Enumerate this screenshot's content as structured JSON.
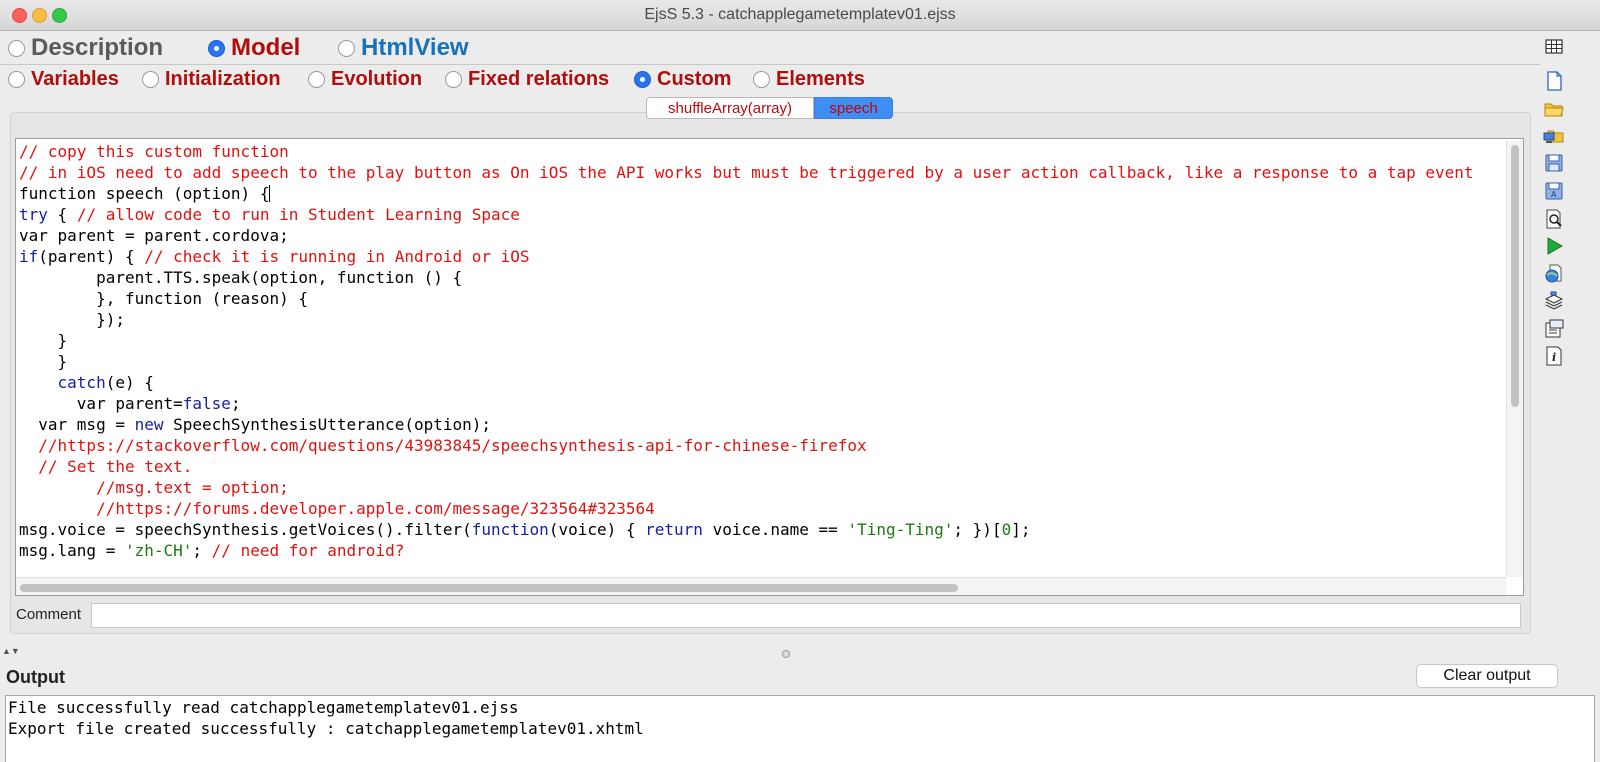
{
  "window": {
    "title": "EjsS 5.3 - catchapplegametemplatev01.ejss"
  },
  "top_nav": [
    {
      "label": "Description",
      "selected": false,
      "color": "#5a5a5a"
    },
    {
      "label": "Model",
      "selected": true,
      "color": "#b20d0d"
    },
    {
      "label": "HtmlView",
      "selected": false,
      "color": "#1772b8"
    }
  ],
  "model_nav": [
    {
      "label": "Variables",
      "selected": false
    },
    {
      "label": "Initialization",
      "selected": false
    },
    {
      "label": "Evolution",
      "selected": false
    },
    {
      "label": "Fixed relations",
      "selected": false
    },
    {
      "label": "Custom",
      "selected": true
    },
    {
      "label": "Elements",
      "selected": false
    }
  ],
  "page_tabs": [
    {
      "label": "shuffleArray(array)",
      "selected": false
    },
    {
      "label": "speech",
      "selected": true
    }
  ],
  "editor": {
    "lines": [
      "// copy this custom function",
      "// in iOS need to add speech to the play button as On iOS the API works but must be triggered by a user action callback, like a response to a tap event",
      "function speech (option) {",
      "try { // allow code to run in Student Learning Space",
      "var parent = parent.cordova;",
      "if(parent) { // check it is running in Android or iOS",
      "        parent.TTS.speak(option, function () {",
      "        }, function (reason) {",
      "        });",
      "    }",
      "    }",
      "    catch(e) {",
      "      var parent=false;",
      "  var msg = new SpeechSynthesisUtterance(option);",
      "  //https://stackoverflow.com/questions/43983845/speechsynthesis-api-for-chinese-firefox",
      "  // Set the text.",
      "        //msg.text = option;",
      "        //https://forums.developer.apple.com/message/323564#323564",
      "msg.voice = speechSynthesis.getVoices().filter(function(voice) { return voice.name == 'Ting-Ting'; })[0];",
      "msg.lang = 'zh-CH'; // need for android?"
    ]
  },
  "comment": {
    "label": "Comment",
    "value": ""
  },
  "output": {
    "label": "Output",
    "clear_label": "Clear output",
    "lines": [
      "File successfully read catchapplegametemplatev01.ejss",
      "Export file created successfully : catchapplegametemplatev01.xhtml"
    ]
  },
  "toolbar_icons": [
    "table-icon",
    "new-file-icon",
    "open-folder-icon",
    "open-remote-icon",
    "save-icon",
    "save-as-icon",
    "search-icon",
    "run-icon",
    "web-export-icon",
    "package-icon",
    "preferences-icon",
    "info-icon"
  ],
  "colors": {
    "comment": "#e0120f",
    "keyword": "#1520a6",
    "string": "#1b7a10",
    "tab_selected_bg": "#3d8ff4",
    "run": "#21a836"
  }
}
